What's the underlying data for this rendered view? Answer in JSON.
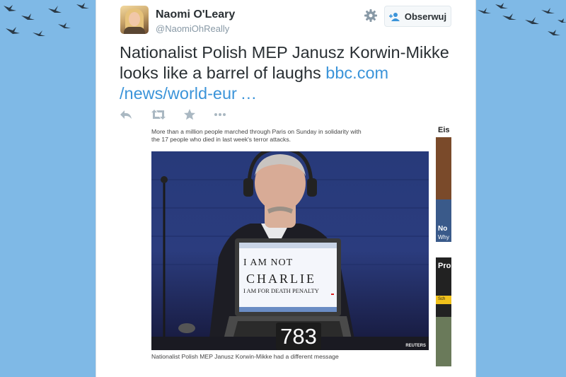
{
  "user": {
    "name": "Naomi O'Leary",
    "handle": "@NaomiOhReally"
  },
  "follow_label": "Obserwuj",
  "tweet": {
    "text_line1": "Nationalist Polish MEP Janusz Korwin-Mikke",
    "text_line2a": "looks like a barrel of laughs ",
    "link_part1": "bbc.com",
    "link_part2": "/news/world-eur …"
  },
  "media": {
    "caption_top": "More than a million people marched through Paris on Sunday in solidarity with the 17 people who died in last week's terror attacks.",
    "screen_line1": "I   AM   NOT",
    "screen_line2": "CHARLIE",
    "screen_line3": "I AM FOR DEATH PENALTY",
    "seat_number": "783",
    "credit": "REUTERS",
    "caption_bottom": "Nationalist Polish MEP Janusz Korwin-Mikke had a different message"
  },
  "side_strip": {
    "top_label": "Eis",
    "mid_label1": "No",
    "mid_label2": "Why",
    "label3": "Pro",
    "label4": "Sch"
  },
  "icons": [
    "reply-icon",
    "retweet-icon",
    "favorite-icon",
    "more-icon",
    "gear-icon",
    "follow-person-icon"
  ],
  "colors": {
    "background": "#7fb9e6",
    "link": "#3b94d9",
    "text": "#292f33",
    "muted": "#8899a6"
  }
}
